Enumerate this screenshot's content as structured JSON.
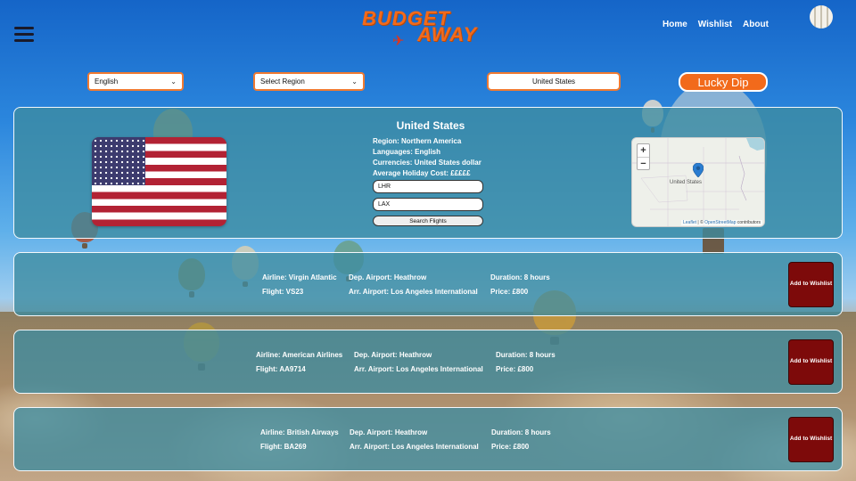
{
  "header": {
    "logo_top": "BUDGET",
    "logo_bottom": "AWAY",
    "nav": [
      "Home",
      "Wishlist",
      "About"
    ],
    "menu_icon": "hamburger-icon"
  },
  "controls": {
    "language_selected": "English",
    "region_selected": "Select Region",
    "country_value": "United States",
    "lucky_dip_label": "Lucky Dip"
  },
  "country": {
    "name": "United States",
    "region": "Region: Northern America",
    "languages": "Languages: English",
    "currencies": "Currencies: United States dollar",
    "holiday_cost": "Average Holiday Cost: £££££",
    "from_airport": "LHR",
    "to_airport": "LAX",
    "search_label": "Search Flights",
    "flag_icon": "us-flag",
    "map": {
      "zoom_in": "+",
      "zoom_out": "−",
      "city_label": "United States",
      "attribution_leaflet": "Leaflet",
      "attribution_sep": " | © ",
      "attribution_osm": "OpenStreetMap",
      "attribution_tail": " contributors"
    }
  },
  "flights": [
    {
      "airline": "Airline: Virgin Atlantic",
      "flight": "Flight: VS23",
      "dep": "Dep. Airport: Heathrow",
      "arr": "Arr. Airport: Los Angeles International",
      "duration": "Duration: 8 hours",
      "price": "Price: £800",
      "button": "Add to Wishlist"
    },
    {
      "airline": "Airline: American Airlines",
      "flight": "Flight: AA9714",
      "dep": "Dep. Airport: Heathrow",
      "arr": "Arr. Airport: Los Angeles International",
      "duration": "Duration: 8 hours",
      "price": "Price: £800",
      "button": "Add to Wishlist"
    },
    {
      "airline": "Airline: British Airways",
      "flight": "Flight: BA269",
      "dep": "Dep. Airport: Heathrow",
      "arr": "Arr. Airport: Los Angeles International",
      "duration": "Duration: 8 hours",
      "price": "Price: £800",
      "button": "Add to Wishlist"
    }
  ],
  "colors": {
    "accent": "#f26a1b",
    "panel": "#3e8ca0",
    "wishlist_button": "#7d0a0a"
  }
}
